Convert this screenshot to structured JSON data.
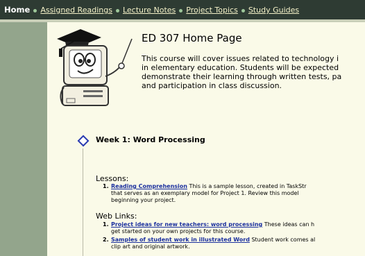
{
  "nav": {
    "home": "Home",
    "links": [
      "Assigned Readings",
      "Lecture Notes",
      "Project Topics",
      "Study Guides"
    ]
  },
  "page": {
    "title": "ED 307 Home Page",
    "intro_lines": [
      "This course will cover issues related to technology i",
      "in elementary education. Students will be expected",
      "demonstrate their learning through written tests, pa",
      "and participation in class discussion."
    ]
  },
  "week": {
    "title": "Week 1: Word Processing",
    "lessons_label": "Lessons:",
    "lessons": [
      {
        "num": "1.",
        "link": "Reading Comprehension",
        "line1": " This is a sample lesson, created in TaskStr",
        "line2": "that serves as an exemplary model for Project 1. Review this model",
        "line3": "beginning your project."
      }
    ],
    "weblinks_label": "Web Links:",
    "weblinks": [
      {
        "num": "1.",
        "link": "Project ideas for new teachers: word processing",
        "line1": " These ideas can h",
        "line2": "get started on your own projects for this course."
      },
      {
        "num": "2.",
        "link": "Samples of student work in illustrated Word",
        "line1": " Student work comes al",
        "line2": "clip art and original artwork."
      }
    ]
  },
  "colors": {
    "topbar": "#2e3b33",
    "sidebar": "#93a58c",
    "background": "#fafae8",
    "link": "#1a2f9e"
  },
  "icons": {
    "clipart": "computer-mascot-graduation-cap-icon",
    "bullet": "diamond-bullet-icon"
  }
}
